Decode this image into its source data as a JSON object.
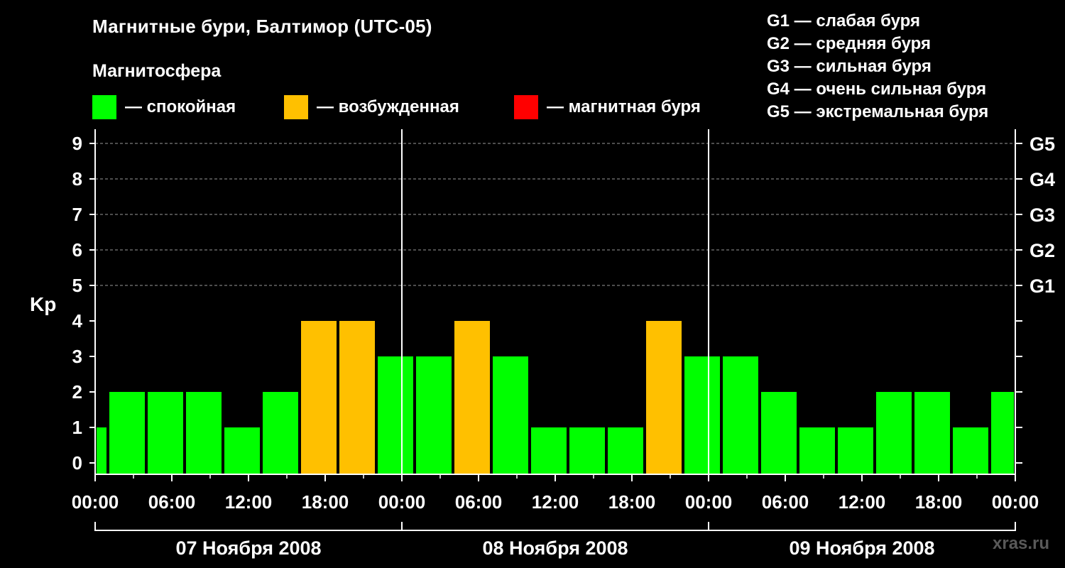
{
  "title": "Магнитные бури, Балтимор (UTC-05)",
  "subtitle": "Магнитосфера",
  "legend": [
    {
      "label": "— спокойная",
      "color": "#00ff00"
    },
    {
      "label": "— возбужденная",
      "color": "#ffc000"
    },
    {
      "label": "— магнитная буря",
      "color": "#ff0000"
    }
  ],
  "g_legend": [
    "G1 — слабая буря",
    "G2 — средняя буря",
    "G3 — сильная буря",
    "G4 — очень сильная буря",
    "G5 — экстремальная буря"
  ],
  "watermark": "xras.ru",
  "chart_data": {
    "type": "bar",
    "ylabel": "Kp",
    "xlabel": "",
    "ylim": [
      0,
      9
    ],
    "y_ticks": [
      "0",
      "1",
      "2",
      "3",
      "4",
      "5",
      "6",
      "7",
      "8",
      "9"
    ],
    "g_scale_ticks": [
      {
        "kp": 5,
        "label": "G1"
      },
      {
        "kp": 6,
        "label": "G2"
      },
      {
        "kp": 7,
        "label": "G3"
      },
      {
        "kp": 8,
        "label": "G4"
      },
      {
        "kp": 9,
        "label": "G5"
      }
    ],
    "x_ticks": [
      "00:00",
      "06:00",
      "12:00",
      "18:00",
      "00:00",
      "06:00",
      "12:00",
      "18:00",
      "00:00",
      "06:00",
      "12:00",
      "18:00",
      "00:00"
    ],
    "days": [
      "07 Ноября 2008",
      "08 Ноября 2008",
      "09 Ноября 2008"
    ],
    "interval_hours": 3,
    "first_bar_start_hour": -2,
    "total_hours": 72,
    "values": [
      1,
      2,
      2,
      2,
      1,
      2,
      4,
      4,
      3,
      3,
      4,
      3,
      1,
      1,
      1,
      4,
      3,
      3,
      2,
      1,
      1,
      2,
      2,
      1,
      2
    ],
    "level_colors": {
      "quiet": "#00ff00",
      "unsettled": "#ffc000",
      "storm": "#ff0000"
    },
    "grid": true
  }
}
